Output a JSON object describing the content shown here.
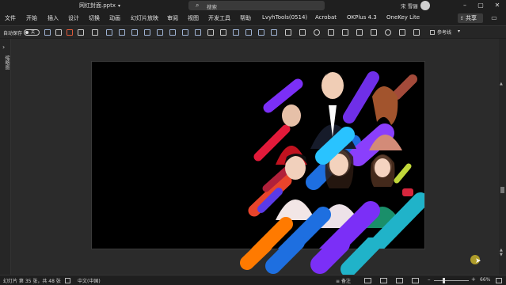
{
  "title_bar": {
    "doc_title": "网红封面.pptx",
    "search_placeholder": "搜索",
    "user_name": "宋 雪骊"
  },
  "menu": {
    "tabs": [
      "文件",
      "开始",
      "插入",
      "设计",
      "切换",
      "动画",
      "幻灯片放映",
      "审阅",
      "视图",
      "开发工具",
      "帮助",
      "LvyhTools(0514)",
      "Acrobat",
      "OKPlus 4.3",
      "OneKey Lite"
    ],
    "share_label": "共享"
  },
  "toolbar": {
    "autosave_label": "自动保存",
    "autosave_state": "关",
    "reference_line_label": "参考线"
  },
  "left_rail": {
    "label": "缩略图"
  },
  "status": {
    "slide_info": "幻灯片 第 35 张，共 48 张",
    "language": "中文(中国)",
    "notes_label": "备注",
    "zoom": "66%"
  },
  "slide": {
    "background": "#000000",
    "stripe_colors": [
      "#7b2ff7",
      "#e8442b",
      "#1e6fe0",
      "#ff7a00",
      "#29c3ff",
      "#8a3ffc",
      "#20b3c9",
      "#b0203a",
      "#5a3be8",
      "#c1d83a",
      "#a34a3a",
      "#e21a3a"
    ]
  }
}
